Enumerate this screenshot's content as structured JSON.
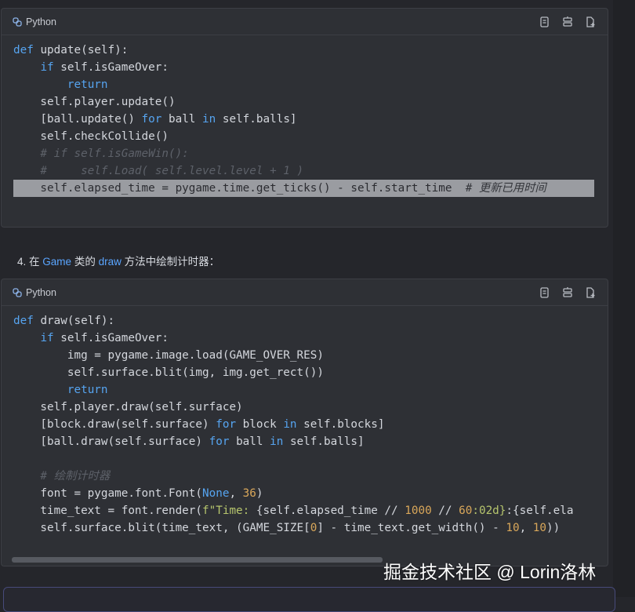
{
  "card1": {
    "language": "Python",
    "lines": [
      [
        {
          "t": "def ",
          "c": "kw"
        },
        {
          "t": "update(self):",
          "c": ""
        }
      ],
      [
        {
          "t": "    ",
          "c": ""
        },
        {
          "t": "if ",
          "c": "kw"
        },
        {
          "t": "self.isGameOver:",
          "c": ""
        }
      ],
      [
        {
          "t": "        ",
          "c": ""
        },
        {
          "t": "return",
          "c": "kw"
        }
      ],
      [
        {
          "t": "    self.player.update()",
          "c": ""
        }
      ],
      [
        {
          "t": "    [ball.update() ",
          "c": ""
        },
        {
          "t": "for ",
          "c": "kw"
        },
        {
          "t": "ball ",
          "c": ""
        },
        {
          "t": "in ",
          "c": "kw"
        },
        {
          "t": "self.balls]",
          "c": ""
        }
      ],
      [
        {
          "t": "    self.checkCollide()",
          "c": ""
        }
      ],
      [
        {
          "t": "    # if self.isGameWin():",
          "c": "cm"
        }
      ],
      [
        {
          "t": "    #     self.Load( self.level.level + 1 )",
          "c": "cm"
        }
      ],
      [
        {
          "t": "    self.elapsed_time = pygame.time.get_ticks() - self.start_time  ",
          "c": ""
        },
        {
          "t": "# 更新已用时间",
          "c": "cmhl"
        }
      ]
    ],
    "highlighted_line": 8
  },
  "step": {
    "number": "4.",
    "prefix": "在",
    "class_ref": "Game",
    "mid": "类的",
    "method_ref": "draw",
    "suffix": "方法中绘制计时器："
  },
  "card2": {
    "language": "Python",
    "lines": [
      [
        {
          "t": "def ",
          "c": "kw"
        },
        {
          "t": "draw(self):",
          "c": ""
        }
      ],
      [
        {
          "t": "    ",
          "c": ""
        },
        {
          "t": "if ",
          "c": "kw"
        },
        {
          "t": "self.isGameOver:",
          "c": ""
        }
      ],
      [
        {
          "t": "        img = pygame.image.load(GAME_OVER_RES)",
          "c": ""
        }
      ],
      [
        {
          "t": "        self.surface.blit(img, img.get_rect())",
          "c": ""
        }
      ],
      [
        {
          "t": "        ",
          "c": ""
        },
        {
          "t": "return",
          "c": "kw"
        }
      ],
      [
        {
          "t": "    self.player.draw(self.surface)",
          "c": ""
        }
      ],
      [
        {
          "t": "    [block.draw(self.surface) ",
          "c": ""
        },
        {
          "t": "for ",
          "c": "kw"
        },
        {
          "t": "block ",
          "c": ""
        },
        {
          "t": "in ",
          "c": "kw"
        },
        {
          "t": "self.blocks]",
          "c": ""
        }
      ],
      [
        {
          "t": "    [ball.draw(self.surface) ",
          "c": ""
        },
        {
          "t": "for ",
          "c": "kw"
        },
        {
          "t": "ball ",
          "c": ""
        },
        {
          "t": "in ",
          "c": "kw"
        },
        {
          "t": "self.balls]",
          "c": ""
        }
      ],
      [
        {
          "t": "",
          "c": ""
        }
      ],
      [
        {
          "t": "    # 绘制计时器",
          "c": "cm"
        }
      ],
      [
        {
          "t": "    font = pygame.font.Font(",
          "c": ""
        },
        {
          "t": "None",
          "c": "kw"
        },
        {
          "t": ", ",
          "c": ""
        },
        {
          "t": "36",
          "c": "num"
        },
        {
          "t": ")",
          "c": ""
        }
      ],
      [
        {
          "t": "    time_text = font.render(",
          "c": ""
        },
        {
          "t": "f\"Time: ",
          "c": "str"
        },
        {
          "t": "{self.elapsed_time // ",
          "c": ""
        },
        {
          "t": "1000",
          "c": "num"
        },
        {
          "t": " // ",
          "c": ""
        },
        {
          "t": "60",
          "c": "num"
        },
        {
          "t": ":02d}",
          "c": "str"
        },
        {
          "t": ":{self.ela",
          "c": ""
        }
      ],
      [
        {
          "t": "    self.surface.blit(time_text, (GAME_SIZE[",
          "c": ""
        },
        {
          "t": "0",
          "c": "num"
        },
        {
          "t": "] - time_text.get_width() - ",
          "c": ""
        },
        {
          "t": "10",
          "c": "num"
        },
        {
          "t": ", ",
          "c": ""
        },
        {
          "t": "10",
          "c": "num"
        },
        {
          "t": "))",
          "c": ""
        }
      ]
    ],
    "highlighted_line": -1
  },
  "watermark": "掘金技术社区 @ Lorin洛林",
  "icons": [
    "python-icon",
    "copy-icon",
    "insert-icon",
    "new-file-icon"
  ]
}
